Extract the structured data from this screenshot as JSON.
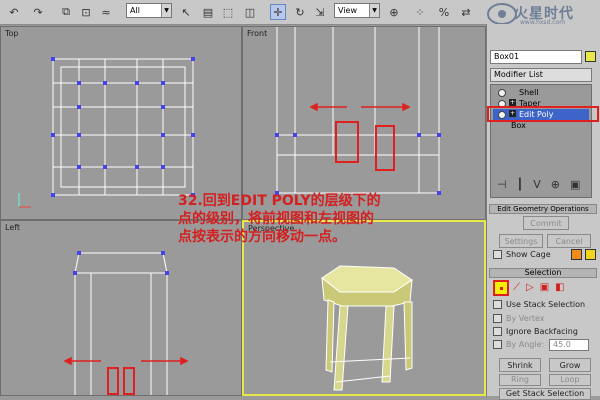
{
  "toolbar": {
    "selection_filter": "All",
    "reference_coord": "View",
    "tools": [
      "undo-icon",
      "redo-icon",
      "select-link-icon",
      "unlink-icon",
      "bind-space-warp-icon",
      "select-object-icon",
      "select-by-name-icon",
      "rectangle-selection-icon",
      "window-crossing-icon",
      "select-move-icon",
      "rotate-icon",
      "scale-icon",
      "pivot-icon",
      "mirror-icon",
      "align-icon"
    ]
  },
  "logo": {
    "text": "火星时代",
    "url": "www.hxsd.com"
  },
  "viewports": {
    "top": "Top",
    "front": "Front",
    "left": "Left",
    "perspective": "Perspective"
  },
  "command_panel": {
    "object_name": "Box01",
    "modifier_list": "Modifier List",
    "stack": [
      "Shell",
      "Taper",
      "Edit Poly",
      "Box"
    ],
    "stack_selected": "Edit Poly",
    "rollout_top": "Edit Geometry Operations",
    "commit": "Commit",
    "settings": "Settings",
    "cancel": "Cancel",
    "show_cage": "Show Cage",
    "selection_title": "Selection",
    "use_stack_selection": "Use Stack Selection",
    "by_vertex": "By Vertex",
    "ignore_backfacing": "Ignore Backfacing",
    "by_angle": "By Angle:",
    "by_angle_value": "45.0",
    "shrink": "Shrink",
    "grow": "Grow",
    "ring": "Ring",
    "loop": "Loop",
    "get_stack_selection": "Get Stack Selection",
    "cage_colors": [
      "#f08c1e",
      "#f2d31e"
    ]
  },
  "instruction": "32.回到EDIT POLY的层级下的\n点的级别，将前视图和左视图的\n点按表示的方向移动一点。",
  "colors": {
    "accent_red": "#d42020",
    "selection_yellow": "#f4f000",
    "stack_highlight": "#3d64c8"
  }
}
